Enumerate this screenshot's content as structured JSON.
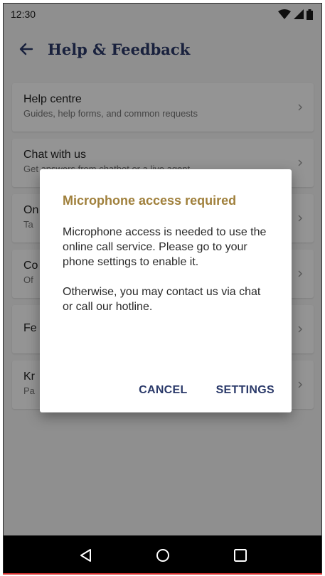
{
  "status_bar": {
    "time": "12:30",
    "icons": [
      "wifi-icon",
      "cell-signal-icon",
      "battery-icon"
    ]
  },
  "app_bar": {
    "title": "Help & Feedback",
    "back_icon": "arrow-left-icon"
  },
  "list": {
    "items": [
      {
        "title": "Help centre",
        "subtitle": "Guides, help forms, and common requests"
      },
      {
        "title": "Chat with us",
        "subtitle": "Get answers from chatbot or a live agent"
      },
      {
        "title": "On",
        "subtitle": "Ta"
      },
      {
        "title": "Co",
        "subtitle": "Of"
      },
      {
        "title": "Fe",
        "subtitle": ""
      },
      {
        "title": "Kr",
        "subtitle": "Pa"
      }
    ]
  },
  "dialog": {
    "title": "Microphone access required",
    "body_1": "Microphone access is needed to use the online call service. Please go to your phone settings to enable it.",
    "body_2": "Otherwise, you may contact us via chat or call our hotline.",
    "cancel_label": "CANCEL",
    "settings_label": "SETTINGS"
  },
  "nav_bar": {
    "icons": [
      "back-triangle-icon",
      "home-circle-icon",
      "recents-square-icon"
    ]
  },
  "colors": {
    "title_blue": "#2b3a6a",
    "dialog_title": "#a0803c",
    "background": "#f7f7f7"
  }
}
